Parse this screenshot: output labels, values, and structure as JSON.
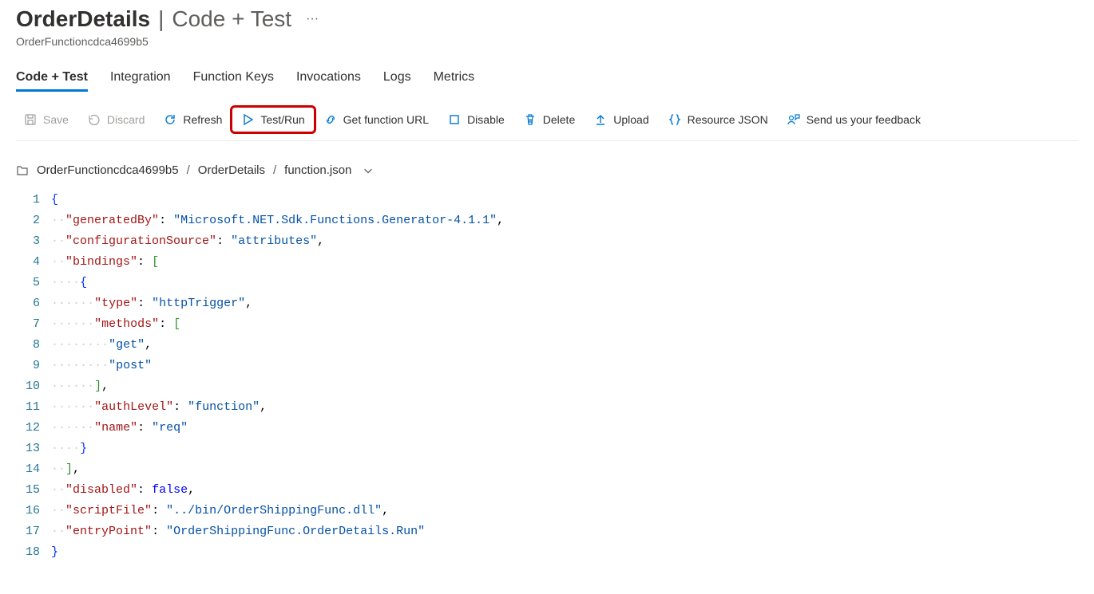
{
  "header": {
    "title_main": "OrderDetails",
    "title_separator": "|",
    "title_sub": "Code + Test",
    "subtitle": "OrderFunctioncdca4699b5"
  },
  "tabs": [
    {
      "label": "Code + Test",
      "active": true
    },
    {
      "label": "Integration",
      "active": false
    },
    {
      "label": "Function Keys",
      "active": false
    },
    {
      "label": "Invocations",
      "active": false
    },
    {
      "label": "Logs",
      "active": false
    },
    {
      "label": "Metrics",
      "active": false
    }
  ],
  "toolbar": {
    "save": "Save",
    "discard": "Discard",
    "refresh": "Refresh",
    "test_run": "Test/Run",
    "get_url": "Get function URL",
    "disable": "Disable",
    "delete": "Delete",
    "upload": "Upload",
    "resource_json": "Resource JSON",
    "feedback": "Send us your feedback"
  },
  "breadcrumb": {
    "part1": "OrderFunctioncdca4699b5",
    "part2": "OrderDetails",
    "part3": "function.json",
    "sep": "/"
  },
  "editor": {
    "content": {
      "generatedBy": "Microsoft.NET.Sdk.Functions.Generator-4.1.1",
      "configurationSource": "attributes",
      "bindings": [
        {
          "type": "httpTrigger",
          "methods": [
            "get",
            "post"
          ],
          "authLevel": "function",
          "name": "req"
        }
      ],
      "disabled": false,
      "scriptFile": "../bin/OrderShippingFunc.dll",
      "entryPoint": "OrderShippingFunc.OrderDetails.Run"
    },
    "line_count": 18
  }
}
